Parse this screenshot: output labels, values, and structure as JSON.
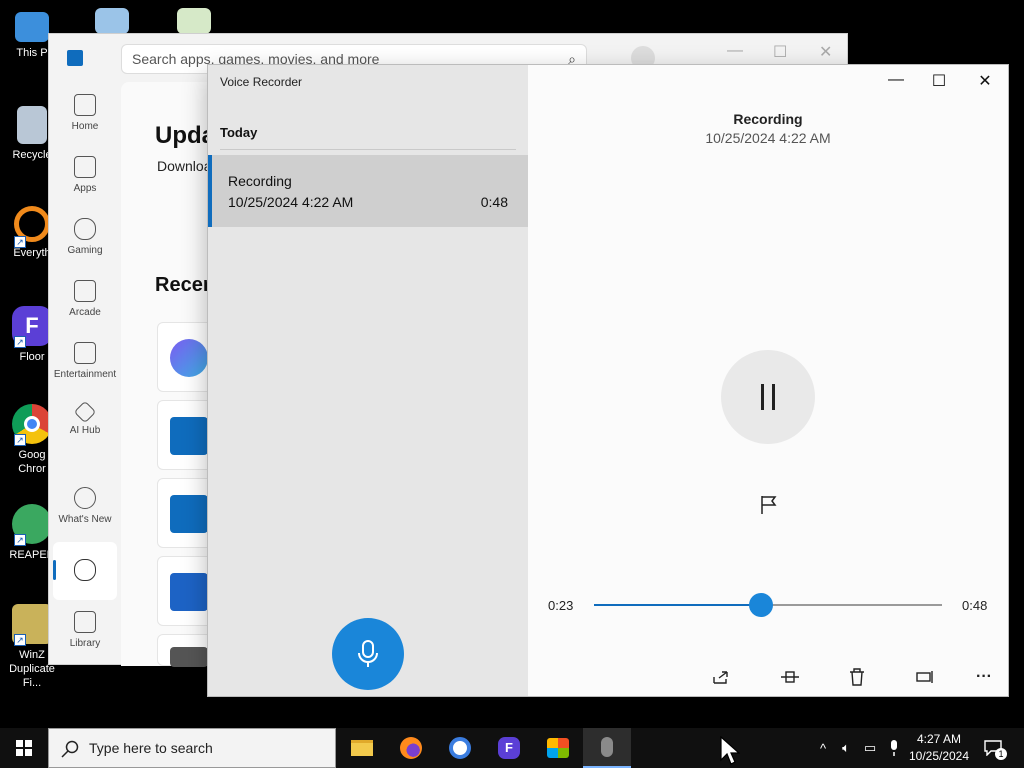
{
  "desktop": {
    "icons": [
      {
        "label": "This P",
        "icon": "computer-icon"
      },
      {
        "label": "Recycle",
        "icon": "recycle-bin-icon"
      },
      {
        "label": "Everyth",
        "icon": "everything-app-icon"
      },
      {
        "label": "Floor",
        "icon": "floorp-app-icon"
      },
      {
        "label": "Goog\nChror",
        "icon": "chrome-icon"
      },
      {
        "label": "REAPER",
        "icon": "reaper-icon"
      },
      {
        "label": "WinZ\nDuplicate Fi...",
        "icon": "winzip-duplicate-finder-icon"
      }
    ]
  },
  "store": {
    "search_placeholder": "Search apps, games, movies, and more",
    "nav": [
      {
        "label": "Home",
        "icon": "home-icon"
      },
      {
        "label": "Apps",
        "icon": "apps-icon"
      },
      {
        "label": "Gaming",
        "icon": "gamepad-icon"
      },
      {
        "label": "Arcade",
        "icon": "joystick-icon"
      },
      {
        "label": "Entertainment",
        "icon": "clapperboard-icon"
      },
      {
        "label": "AI Hub",
        "icon": "sparkle-icon"
      },
      {
        "label": "What's New",
        "icon": "megaphone-icon"
      },
      {
        "label": "",
        "icon": "cloud-download-icon"
      },
      {
        "label": "Library",
        "icon": "library-icon"
      }
    ],
    "heading": "Upda",
    "subheading": "Downloa",
    "recent_heading": "Recen"
  },
  "voice_recorder": {
    "title": "Voice Recorder",
    "section_label": "Today",
    "recordings": [
      {
        "name": "Recording",
        "date": "10/25/2024 4:22 AM",
        "duration": "0:48"
      }
    ],
    "current": {
      "title": "Recording",
      "date": "10/25/2024 4:22 AM",
      "elapsed": "0:23",
      "total": "0:48",
      "progress": 0.48
    },
    "accent_color": "#1a86d9"
  },
  "taskbar": {
    "search_placeholder": "Type here to search",
    "time": "4:27 AM",
    "date": "10/25/2024",
    "notification_count": "1"
  }
}
